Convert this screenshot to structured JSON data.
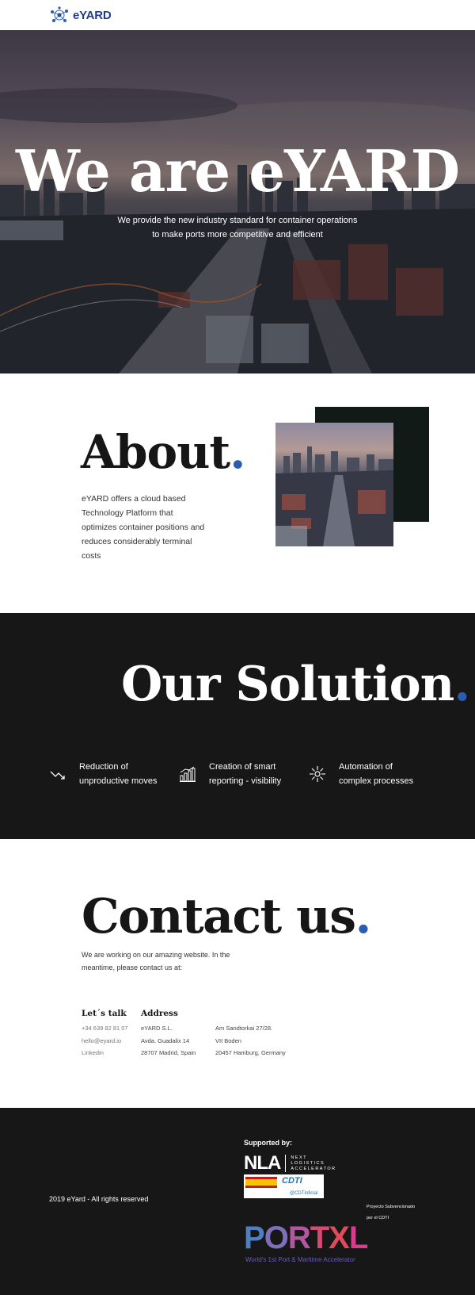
{
  "header": {
    "brand": "eYARD",
    "logo_icon": "network-nodes-icon",
    "brand_color": "#1f3f85"
  },
  "hero": {
    "title": "We are eYARD",
    "subtitle_line1": "We provide the new industry standard for container operations",
    "subtitle_line2": "to make ports more competitive and efficient"
  },
  "about": {
    "title": "About",
    "dot": ".",
    "text": "eYARD offers a cloud based Technology Platform that optimizes container positions and reduces considerably terminal costs"
  },
  "solution": {
    "title": "Our Solution",
    "dot": ".",
    "features": [
      {
        "icon": "trend-down-icon",
        "line1": "Reduction of",
        "line2": "unproductive moves"
      },
      {
        "icon": "bar-chart-icon",
        "line1": "Creation of smart",
        "line2": "reporting - visibility"
      },
      {
        "icon": "automation-spark-icon",
        "line1": "Automation of",
        "line2": "complex processes"
      }
    ]
  },
  "contact": {
    "title": "Contact us",
    "dot": ".",
    "text": "We are working on our amazing website. In the meantime, please contact us at:",
    "lets_talk": {
      "heading": "Let´s talk",
      "phone": "+34 639 82 81 07",
      "email": "hello@eyard.io",
      "linkedin": "Linkedin"
    },
    "address": {
      "heading": "Address",
      "col1": [
        "eYARD S.L.",
        "Avda. Guadalix 14",
        "28707 Madrid, Spain"
      ],
      "col2": [
        "Am Sandtorkai 27/28.",
        "VII Boden",
        "20457 Hamburg, Germany"
      ]
    }
  },
  "footer": {
    "copyright": "2019 eYard - All rights reserved",
    "supported_by": "Supported by:",
    "nla_letters": "NLA",
    "nla_sub": [
      "NEXT",
      "LOGISTICS",
      "ACCELERATOR"
    ],
    "cdti_logo": "CDTI",
    "cdti_handle": "@CDTIoficial",
    "proyecto_line1": "Proyecto Subvencionado",
    "proyecto_line2": "por el CDTI",
    "portxl": "PORTXL",
    "portxl_sub": "World's 1st Port & Maritime Accelerator"
  },
  "colors": {
    "accent_blue": "#2a5db0",
    "dark_bg": "#171717",
    "nla_teal": "#14b7c9"
  }
}
